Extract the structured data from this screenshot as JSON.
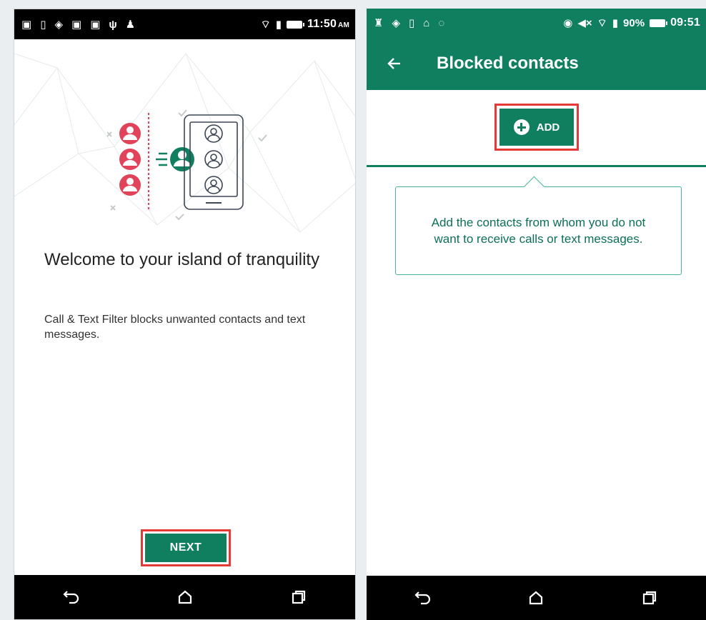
{
  "left_screen": {
    "status_bar": {
      "time": "11:50",
      "time_suffix": "AM"
    },
    "welcome_title": "Welcome to your island of tranquility",
    "welcome_text": "Call & Text Filter blocks unwanted contacts and text messages.",
    "next_label": "NEXT"
  },
  "right_screen": {
    "status_bar": {
      "battery": "90%",
      "time": "09:51"
    },
    "title": "Blocked contacts",
    "add_label": "ADD",
    "hint": "Add the contacts from whom you do not want to receive calls or text messages."
  },
  "colors": {
    "accent": "#0f7f60",
    "highlight": "#e53935",
    "contact_red": "#e0435a"
  },
  "icons": [
    "back-arrow-icon",
    "plus-circle-icon",
    "nav-back-icon",
    "nav-home-icon",
    "nav-recents-icon",
    "contact-icon",
    "phone-icon"
  ]
}
